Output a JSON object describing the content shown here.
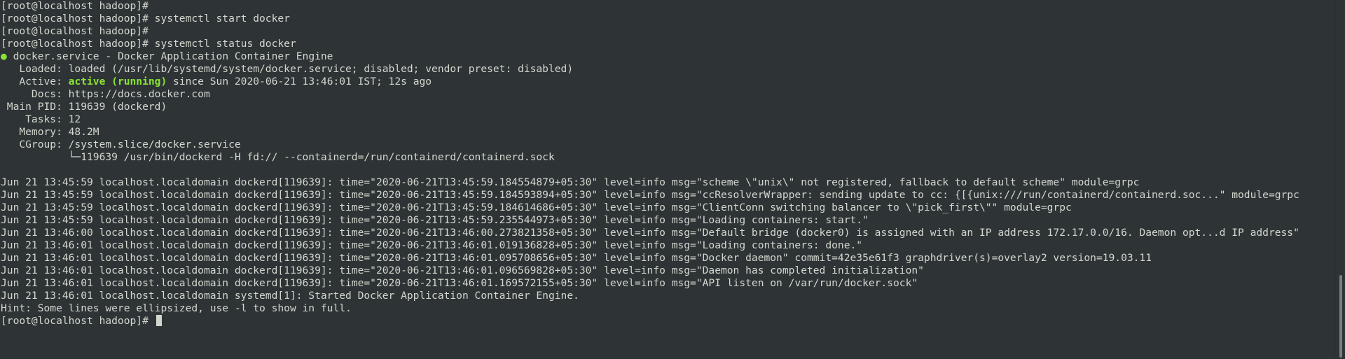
{
  "terminal": {
    "lines": [
      "[root@localhost hadoop]#",
      "[root@localhost hadoop]# systemctl start docker",
      "[root@localhost hadoop]#",
      "[root@localhost hadoop]# systemctl status docker"
    ],
    "status": {
      "dot": "●",
      "title": " docker.service - Docker Application Container Engine",
      "loaded": "   Loaded: loaded (/usr/lib/systemd/system/docker.service; disabled; vendor preset: disabled)",
      "active_label": "   Active: ",
      "active_state": "active (running)",
      "active_rest": " since Sun 2020-06-21 13:46:01 IST; 12s ago",
      "docs": "     Docs: https://docs.docker.com",
      "main_pid": " Main PID: 119639 (dockerd)",
      "tasks": "    Tasks: 12",
      "memory": "   Memory: 48.2M",
      "cgroup": "   CGroup: /system.slice/docker.service",
      "cgroup_child": "           └─119639 /usr/bin/dockerd -H fd:// --containerd=/run/containerd/containerd.sock"
    },
    "logs": [
      "Jun 21 13:45:59 localhost.localdomain dockerd[119639]: time=\"2020-06-21T13:45:59.184554879+05:30\" level=info msg=\"scheme \\\"unix\\\" not registered, fallback to default scheme\" module=grpc",
      "Jun 21 13:45:59 localhost.localdomain dockerd[119639]: time=\"2020-06-21T13:45:59.184593894+05:30\" level=info msg=\"ccResolverWrapper: sending update to cc: {[{unix:///run/containerd/containerd.soc...\" module=grpc",
      "Jun 21 13:45:59 localhost.localdomain dockerd[119639]: time=\"2020-06-21T13:45:59.184614686+05:30\" level=info msg=\"ClientConn switching balancer to \\\"pick_first\\\"\" module=grpc",
      "Jun 21 13:45:59 localhost.localdomain dockerd[119639]: time=\"2020-06-21T13:45:59.235544973+05:30\" level=info msg=\"Loading containers: start.\"",
      "Jun 21 13:46:00 localhost.localdomain dockerd[119639]: time=\"2020-06-21T13:46:00.273821358+05:30\" level=info msg=\"Default bridge (docker0) is assigned with an IP address 172.17.0.0/16. Daemon opt...d IP address\"",
      "Jun 21 13:46:01 localhost.localdomain dockerd[119639]: time=\"2020-06-21T13:46:01.019136828+05:30\" level=info msg=\"Loading containers: done.\"",
      "Jun 21 13:46:01 localhost.localdomain dockerd[119639]: time=\"2020-06-21T13:46:01.095708656+05:30\" level=info msg=\"Docker daemon\" commit=42e35e61f3 graphdriver(s)=overlay2 version=19.03.11",
      "Jun 21 13:46:01 localhost.localdomain dockerd[119639]: time=\"2020-06-21T13:46:01.096569828+05:30\" level=info msg=\"Daemon has completed initialization\"",
      "Jun 21 13:46:01 localhost.localdomain dockerd[119639]: time=\"2020-06-21T13:46:01.169572155+05:30\" level=info msg=\"API listen on /var/run/docker.sock\"",
      "Jun 21 13:46:01 localhost.localdomain systemd[1]: Started Docker Application Container Engine.",
      "Hint: Some lines were ellipsized, use -l to show in full."
    ],
    "prompt": "[root@localhost hadoop]# ",
    "scroll_fraction_visible": 0.23,
    "colors": {
      "background": "#2e3436",
      "foreground": "#d3d7cf",
      "active_green": "#8ae234"
    }
  }
}
